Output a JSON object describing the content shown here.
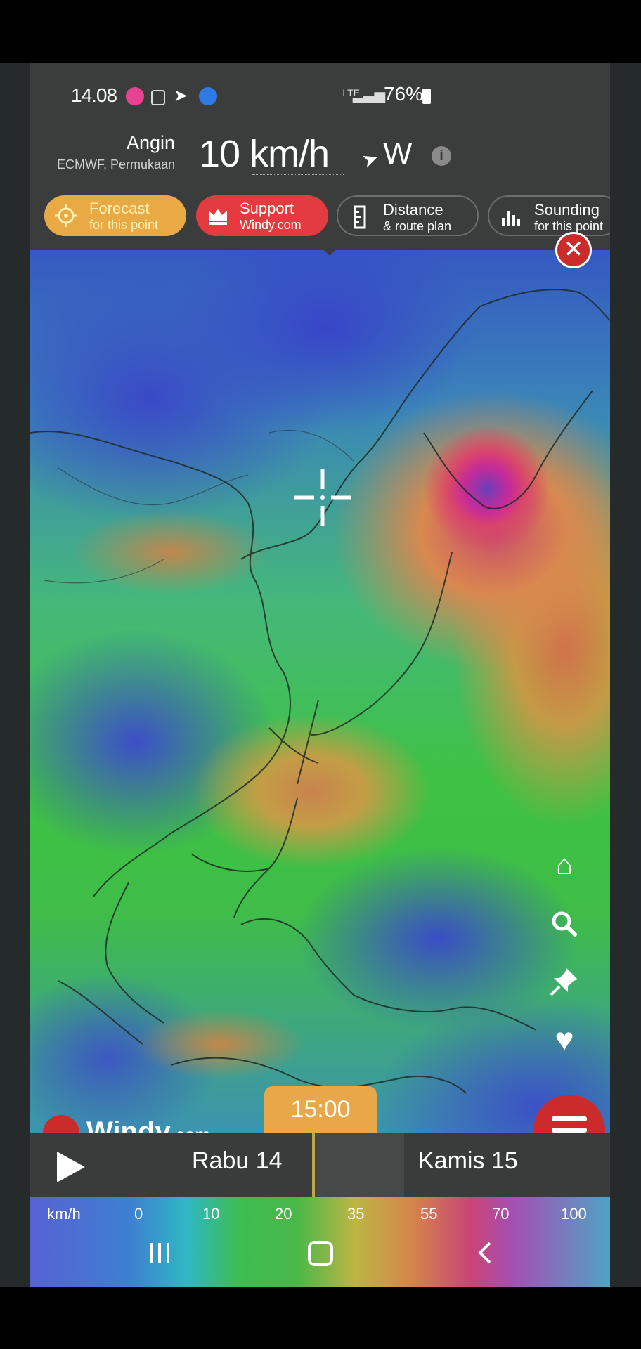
{
  "status_bar": {
    "time": "14.08",
    "network": "LTE",
    "battery": "76%"
  },
  "header": {
    "layer_label": "Angin",
    "model_label": "ECMWF, Permukaan",
    "wind_speed": "10 km/h",
    "wind_direction": "W"
  },
  "actions": {
    "forecast": {
      "title": "Forecast",
      "subtitle": "for this point"
    },
    "support": {
      "title": "Support",
      "subtitle": "Windy.com"
    },
    "distance": {
      "title": "Distance",
      "subtitle": "& route plan"
    },
    "sounding": {
      "title": "Sounding",
      "subtitle": "for this point"
    }
  },
  "map": {
    "logo_text": "Windy",
    "logo_suffix": ".com"
  },
  "side_icons": [
    "home-icon",
    "search-icon",
    "pin-icon",
    "heart-icon"
  ],
  "timeline": {
    "current_time": "15:00",
    "day1": "Rabu 14",
    "day2": "Kamis 15"
  },
  "legend": {
    "unit": "km/h",
    "values": [
      "0",
      "10",
      "20",
      "35",
      "55",
      "70",
      "100"
    ]
  },
  "colors": {
    "accent_orange": "#e9a945",
    "accent_red": "#e33b3f",
    "close_red": "#cc2b2b"
  }
}
